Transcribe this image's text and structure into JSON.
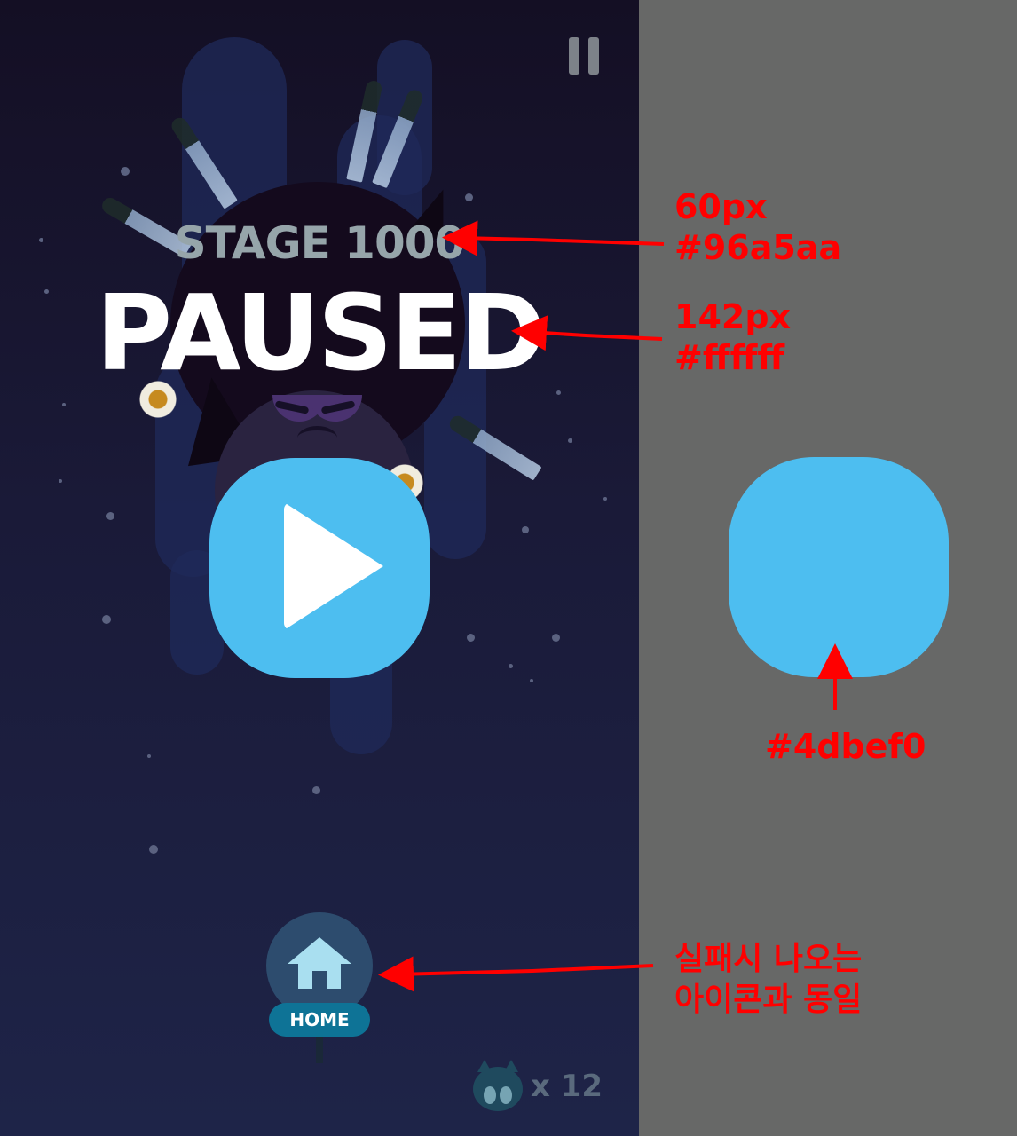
{
  "game": {
    "stage_label": "STAGE 1000",
    "paused_label": "PAUSED",
    "play_icon": "play-triangle-icon",
    "pause_icon": "pause-icon",
    "home": {
      "icon": "house-icon",
      "label": "HOME"
    },
    "lives": {
      "icon": "creature-face-icon",
      "count_text": "x 12"
    }
  },
  "annotations": {
    "stage_spec": {
      "size": "60px",
      "color": "#96a5aa"
    },
    "paused_spec": {
      "size": "142px",
      "color": "#ffffff"
    },
    "button_color": "#4dbef0",
    "home_note": {
      "line1": "실패시 나오는",
      "line2": "아이콘과 동일"
    }
  },
  "colors": {
    "stage_text": "#96a5aa",
    "paused_text": "#ffffff",
    "play_button": "#4dbef0",
    "annotation": "#ff0000",
    "right_panel_bg": "#676867"
  }
}
